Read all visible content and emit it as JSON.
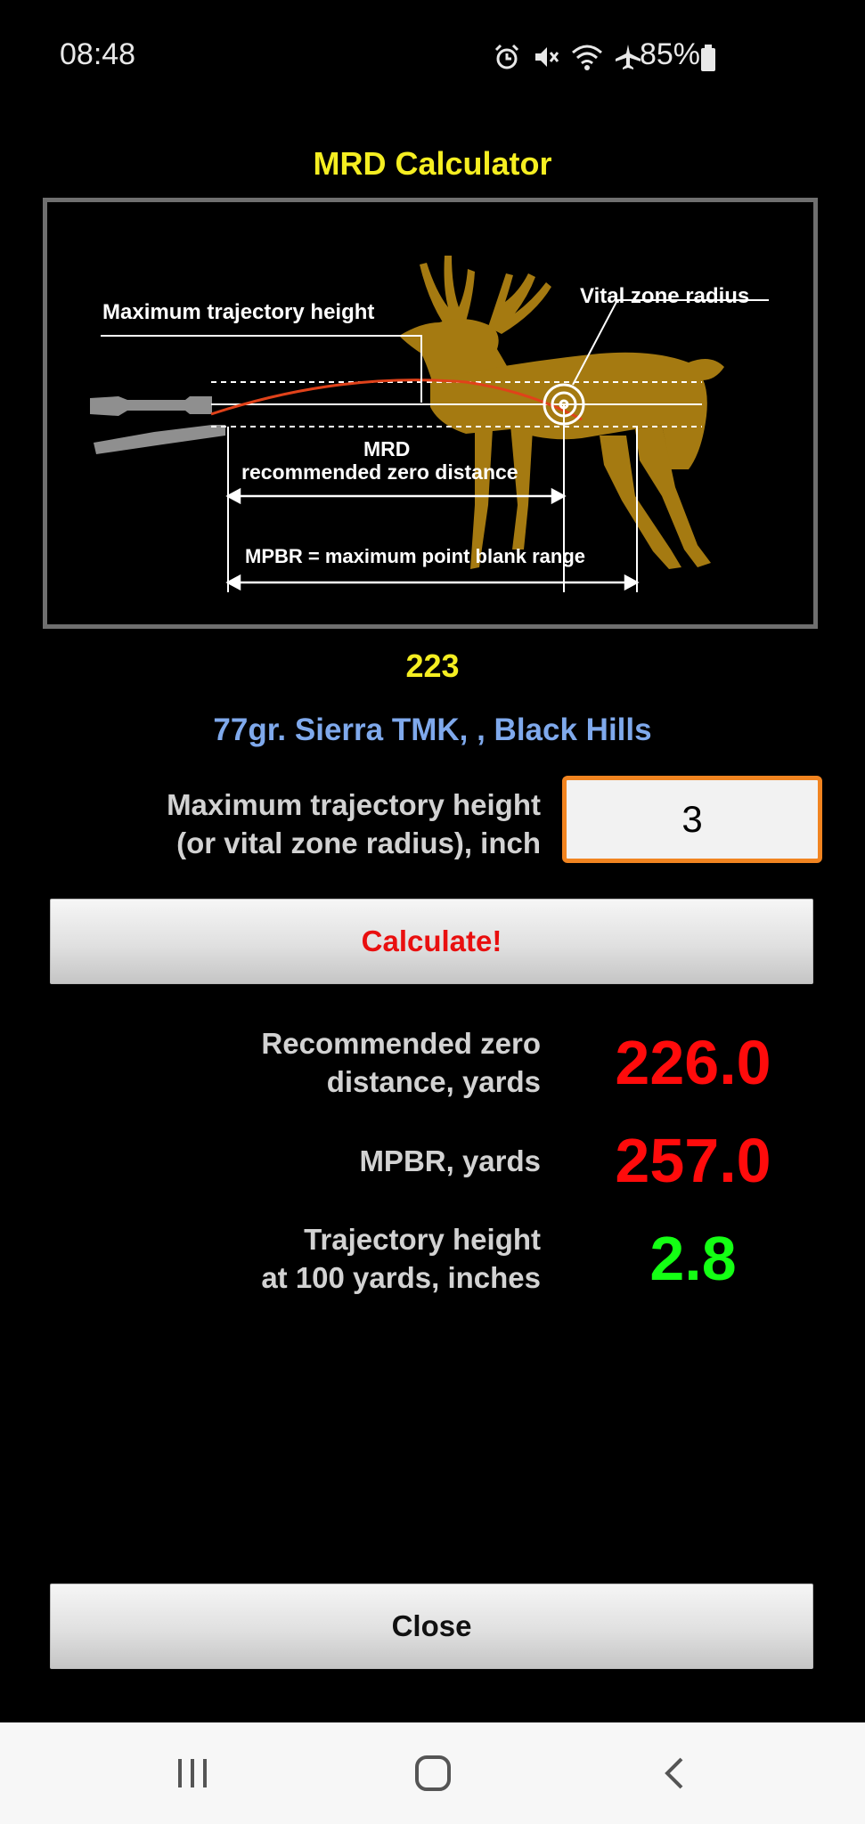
{
  "status_bar": {
    "time": "08:48",
    "battery": "85%",
    "icons": [
      "alarm-icon",
      "mute-icon",
      "wifi-icon",
      "airplane-icon",
      "battery-icon"
    ]
  },
  "title": "MRD Calculator",
  "diagram": {
    "label_max_height": "Maximum trajectory height",
    "label_vital_zone": "Vital zone radius",
    "label_mrd": "MRD",
    "label_mrd_sub": "recommended zero distance",
    "label_mpbr": "MPBR = maximum point blank range"
  },
  "caliber": "223",
  "ammo": "77gr. Sierra TMK, , Black Hills",
  "input": {
    "label_line1": "Maximum trajectory height",
    "label_line2": "(or vital zone radius), inch",
    "value": "3"
  },
  "calculate_label": "Calculate!",
  "results": {
    "zero": {
      "label_line1": "Recommended zero",
      "label_line2": "distance, yards",
      "value": "226.0"
    },
    "mpbr": {
      "label": "MPBR, yards",
      "value": "257.0"
    },
    "height100": {
      "label_line1": "Trajectory height",
      "label_line2": "at 100 yards, inches",
      "value": "2.8"
    }
  },
  "close_label": "Close",
  "colors": {
    "title": "#f5ee21",
    "ammo": "#7fa9ec",
    "result_red": "#ff0b0b",
    "result_green": "#14ff14",
    "input_border": "#f18420",
    "deer": "#a57a11"
  }
}
